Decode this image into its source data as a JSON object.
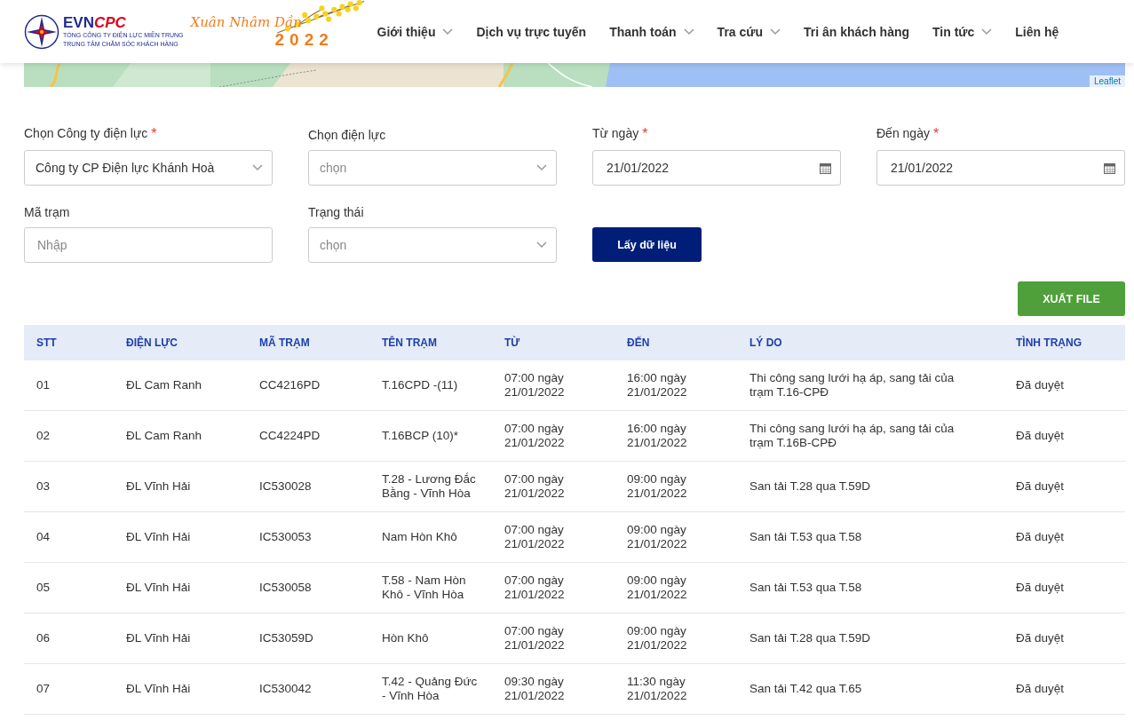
{
  "header": {
    "logo": {
      "brand_a": "EVN",
      "brand_b": "CPC",
      "line_1": "TỔNG CÔNG TY ĐIỆN LỰC MIỀN TRUNG",
      "line_2": "TRUNG TÂM CHĂM SÓC KHÁCH HÀNG"
    },
    "banner": {
      "script": "Xuân Nhâm Dần",
      "year": "2022"
    },
    "nav": [
      {
        "label": "Giới thiệu",
        "has_dropdown": true
      },
      {
        "label": "Dịch vụ trực tuyến",
        "has_dropdown": false
      },
      {
        "label": "Thanh toán",
        "has_dropdown": true
      },
      {
        "label": "Tra cứu",
        "has_dropdown": true
      },
      {
        "label": "Tri ân khách hàng",
        "has_dropdown": false
      },
      {
        "label": "Tin tức",
        "has_dropdown": true
      },
      {
        "label": "Liên hệ",
        "has_dropdown": false
      }
    ]
  },
  "map": {
    "attribution": "Leaflet"
  },
  "filters": [
    {
      "kind": "select",
      "label": "Chọn Công ty điện lực",
      "required_mark": "*",
      "value": "Công ty CP Điện lực Khánh Hoà"
    },
    {
      "kind": "select",
      "label": "Chọn điện lực",
      "placeholder": "chọn"
    },
    {
      "kind": "date",
      "label": "Từ ngày",
      "required_mark": "*",
      "value": "21/01/2022"
    },
    {
      "kind": "date",
      "label": "Đến ngày",
      "required_mark": "*",
      "value": "21/01/2022"
    },
    {
      "kind": "input",
      "label": "Mã trạm",
      "placeholder": "Nhập"
    },
    {
      "kind": "select",
      "label": "Trạng thái",
      "placeholder": "chọn"
    },
    {
      "kind": "button",
      "label": "Lấy dữ liệu"
    }
  ],
  "export_button": "XUẤT FILE",
  "table": {
    "columns": [
      "STT",
      "ĐIỆN LỰC",
      "MÃ TRẠM",
      "TÊN TRẠM",
      "TỪ",
      "ĐẾN",
      "LÝ DO",
      "TÌNH TRẠNG"
    ],
    "rows": [
      [
        "01",
        "ĐL Cam Ranh",
        "CC4216PD",
        "T.16CPD -(11)",
        "07:00 ngày 21/01/2022",
        "16:00 ngày 21/01/2022",
        "Thi công sang lưới hạ áp, sang tải của trạm T.16-CPĐ",
        "Đã duyệt"
      ],
      [
        "02",
        "ĐL Cam Ranh",
        "CC4224PD",
        "T.16BCP (10)*",
        "07:00 ngày 21/01/2022",
        "16:00 ngày 21/01/2022",
        "Thi công sang lưới hạ áp, sang tải của trạm T.16B-CPĐ",
        "Đã duyệt"
      ],
      [
        "03",
        "ĐL Vĩnh Hải",
        "IC530028",
        "T.28 - Lương Đắc Bằng - Vĩnh Hòa",
        "07:00 ngày 21/01/2022",
        "09:00 ngày 21/01/2022",
        "San tải T.28 qua T.59D",
        "Đã duyệt"
      ],
      [
        "04",
        "ĐL Vĩnh Hải",
        "IC530053",
        "Nam Hòn Khô",
        "07:00 ngày 21/01/2022",
        "09:00 ngày 21/01/2022",
        "San tải T.53 qua T.58",
        "Đã duyệt"
      ],
      [
        "05",
        "ĐL Vĩnh Hải",
        "IC530058",
        "T.58 - Nam Hòn Khô - Vĩnh Hòa",
        "07:00 ngày 21/01/2022",
        "09:00 ngày 21/01/2022",
        "San tải T.53 qua T.58",
        "Đã duyệt"
      ],
      [
        "06",
        "ĐL Vĩnh Hải",
        "IC53059D",
        "Hòn Khô",
        "07:00 ngày 21/01/2022",
        "09:00 ngày 21/01/2022",
        "San tải T.28 qua T.59D",
        "Đã duyệt"
      ],
      [
        "07",
        "ĐL Vĩnh Hải",
        "IC530042",
        "T.42 - Quảng Đức - Vĩnh Hòa",
        "09:30 ngày 21/01/2022",
        "11:30 ngày 21/01/2022",
        "San tải T.42 qua T.65",
        "Đã duyệt"
      ]
    ]
  }
}
